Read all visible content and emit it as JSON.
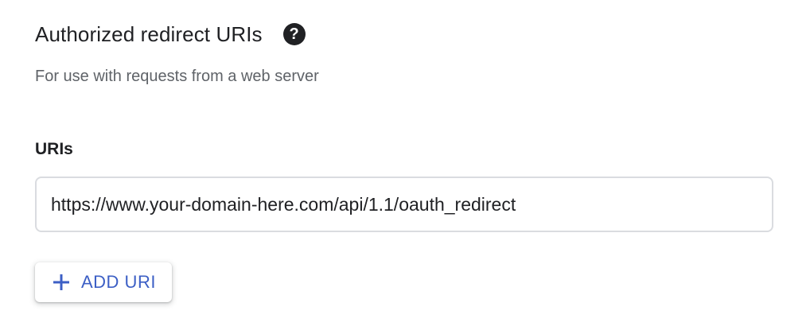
{
  "section": {
    "title": "Authorized redirect URIs",
    "help_icon": "help-circle-icon",
    "subtitle": "For use with requests from a web server"
  },
  "uris": {
    "label": "URIs",
    "values": [
      "https://www.your-domain-here.com/api/1.1/oauth_redirect"
    ]
  },
  "add_button": {
    "icon": "plus-icon",
    "label": "ADD URI"
  },
  "colors": {
    "accent": "#3c5fc5",
    "text_primary": "#202124",
    "text_secondary": "#5f6368",
    "border": "#dadce0"
  }
}
